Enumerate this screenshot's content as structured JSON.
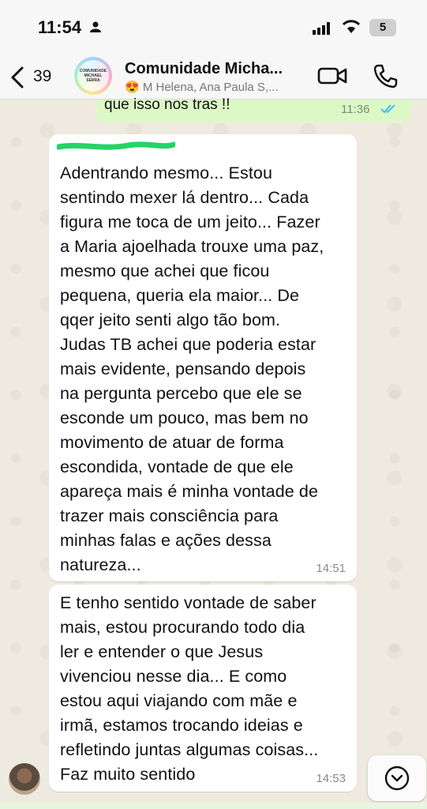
{
  "status_bar": {
    "time": "11:54",
    "battery": "5"
  },
  "header": {
    "back_count": "39",
    "title": "Comunidade Micha...",
    "subtitle": "😍 M Helena, Ana Paula S,...",
    "avatar_text": "COMUNIDADE MICHAEL SERRA"
  },
  "messages": [
    {
      "type": "outgoing",
      "text": "que isso nos tras !!",
      "time": "11:36"
    },
    {
      "type": "incoming",
      "text": "Adentrando mesmo... Estou\nsentindo mexer lá dentro... Cada\nfigura me toca de um jeito... Fazer\na Maria ajoelhada trouxe uma paz,\nmesmo que achei que ficou\npequena, queria ela maior... De\nqqer jeito senti algo tão bom.\nJudas TB achei que poderia estar\nmais evidente, pensando depois\nna pergunta percebo que ele se\nesconde um pouco, mas bem no\nmovimento de atuar de forma\nescondida, vontade de que ele\napareça mais é minha vontade de\ntrazer mais consciência para\nminhas falas e ações dessa\nnatureza...",
      "time": "14:51"
    },
    {
      "type": "incoming",
      "text": "E tenho sentido vontade de saber\nmais, estou procurando todo dia\nler e entender o que Jesus\nvivenciou nesse dia... E como\nestou aqui viajando com mãe e\nirmã, estamos trocando ideias e\nrefletindo juntas algumas coisas...\nFaz muito sentido",
      "time": "14:53"
    }
  ],
  "colors": {
    "outgoing_bubble": "#dcf8c6",
    "incoming_bubble": "#ffffff",
    "tick_blue": "#34b7f1",
    "scribble_green": "#25d366"
  }
}
